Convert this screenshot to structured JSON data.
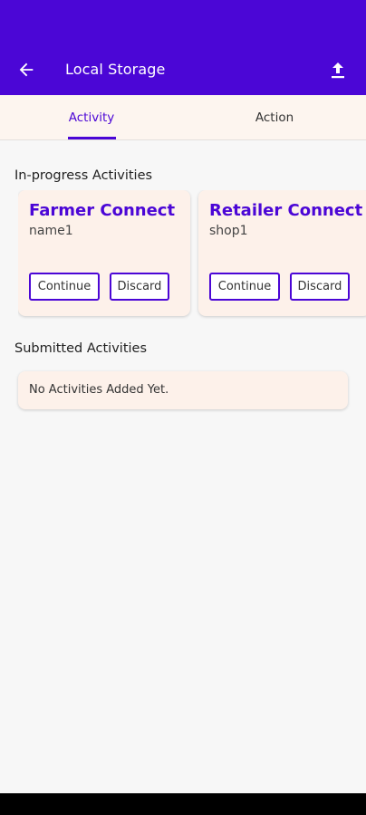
{
  "colors": {
    "primary": "#4b06d6",
    "card_bg": "#fdf1ea",
    "tab_bg": "#fdf5ef"
  },
  "appbar": {
    "title": "Local Storage",
    "back_icon": "arrow-left-icon",
    "action_icon": "upload-icon"
  },
  "tabs": [
    {
      "label": "Activity",
      "selected": true
    },
    {
      "label": "Action",
      "selected": false
    }
  ],
  "in_progress": {
    "title": "In-progress Activities",
    "cards": [
      {
        "title": "Farmer Connect",
        "subtitle": "name1",
        "continue_label": "Continue",
        "discard_label": "Discard"
      },
      {
        "title": "Retailer Connect",
        "subtitle": "shop1",
        "continue_label": "Continue",
        "discard_label": "Discard"
      }
    ]
  },
  "submitted": {
    "title": "Submitted Activities",
    "empty_text": "No Activities Added Yet."
  }
}
